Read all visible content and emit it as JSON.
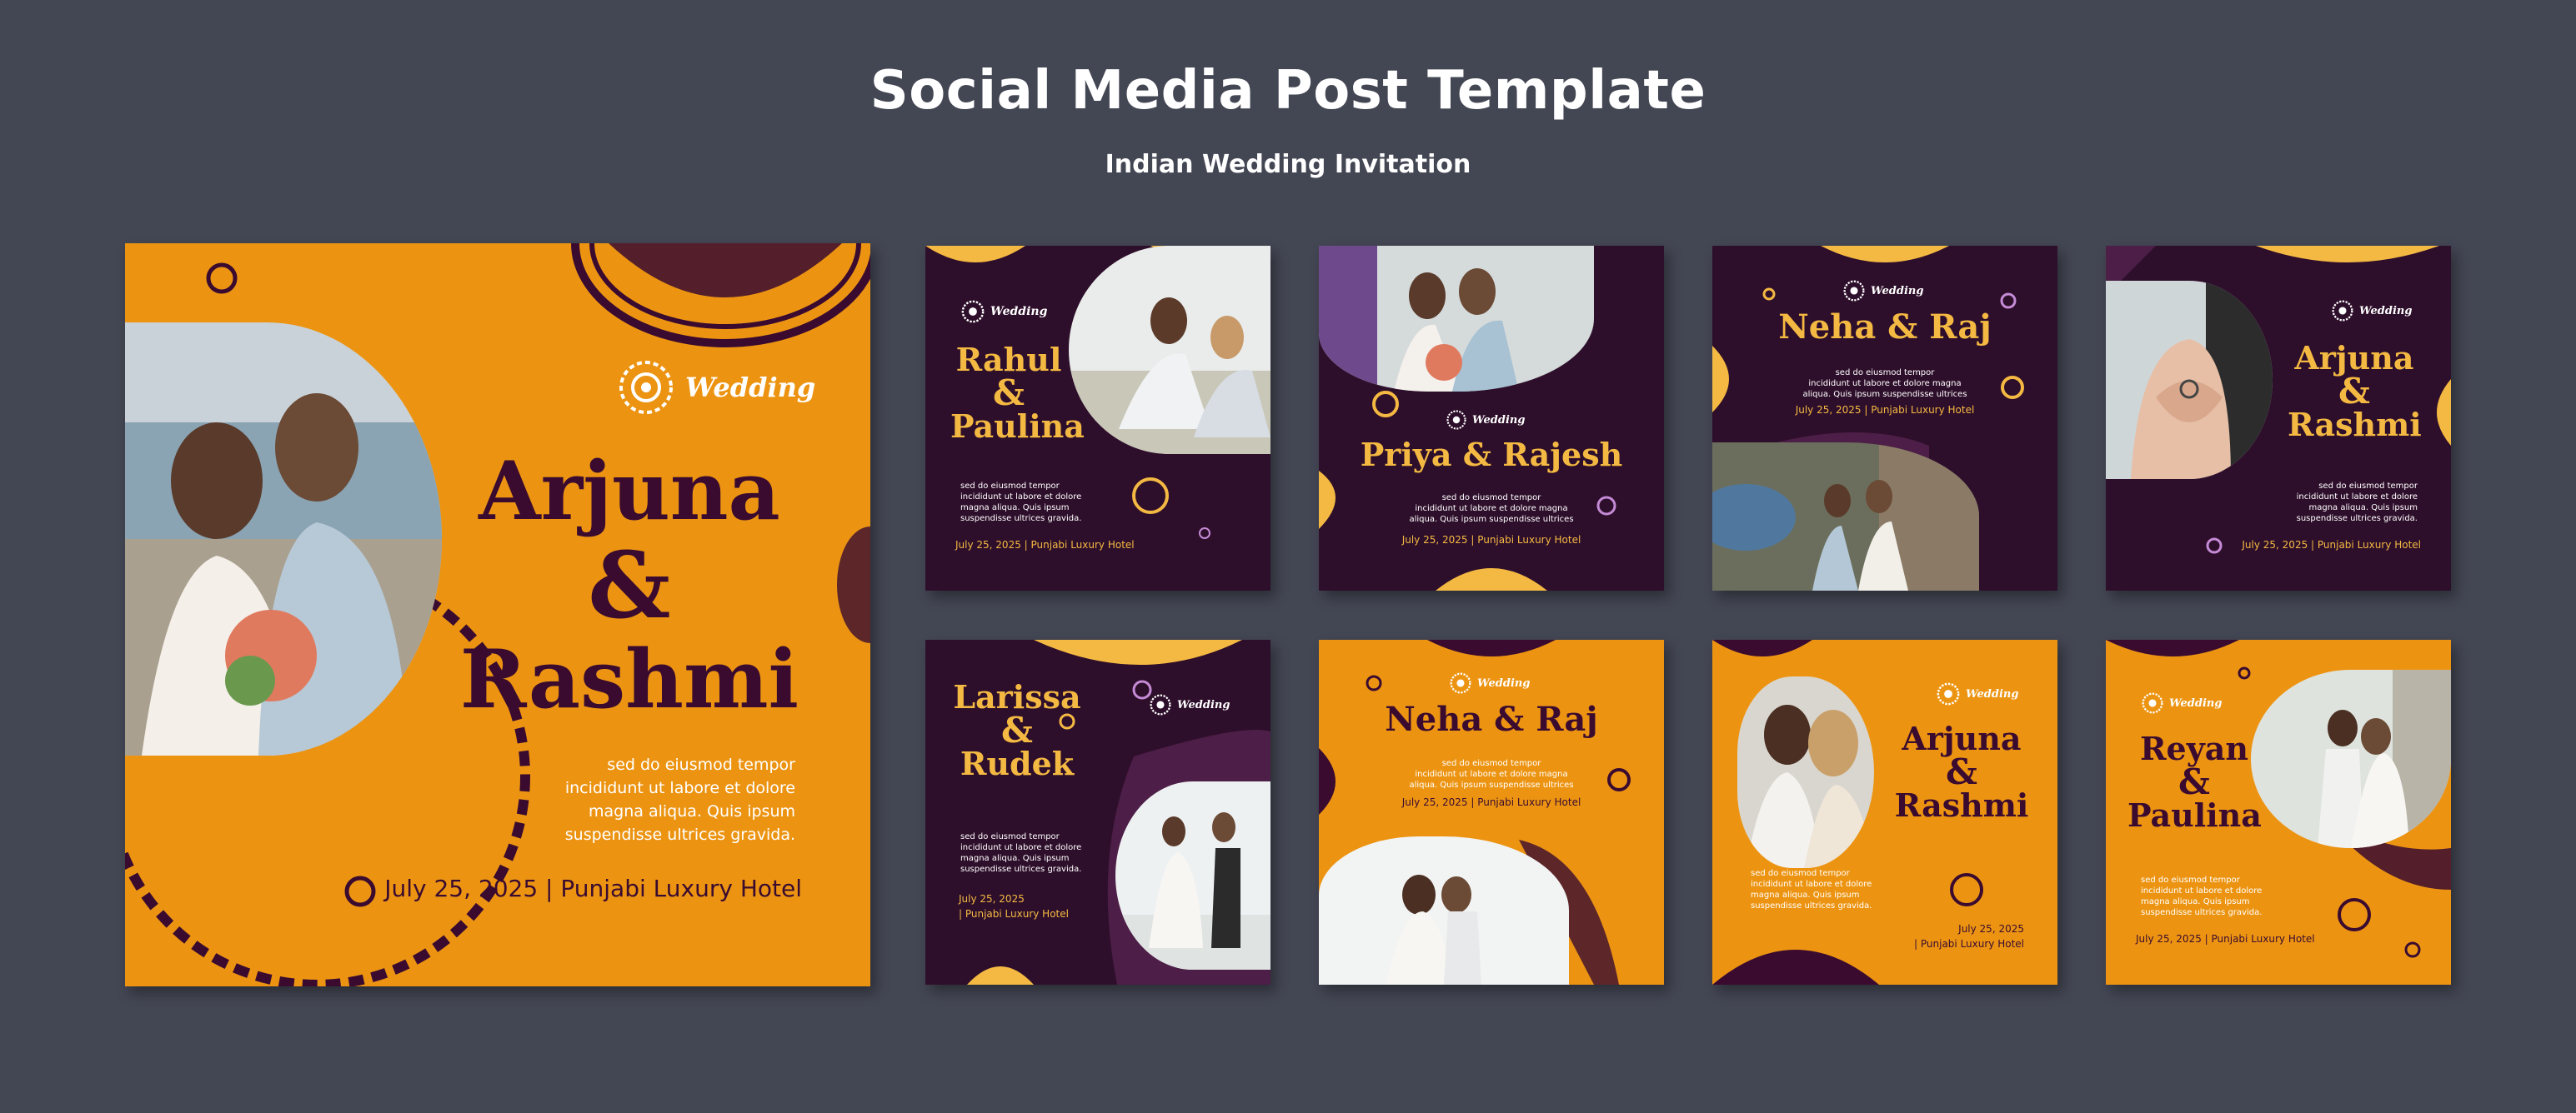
{
  "header": {
    "title": "Social Media Post Template",
    "subtitle": "Indian Wedding Invitation"
  },
  "colors": {
    "background": "#434653",
    "orange": "#ec9412",
    "purple": "#2e0f2b",
    "gold": "#f4b942",
    "dark_text": "#3a0b2f"
  },
  "brand_word": "Wedding",
  "posts": [
    {
      "id": "main",
      "names": [
        "Arjuna",
        "&",
        "Rashmi"
      ],
      "body": [
        "sed do eiusmod tempor",
        "incididunt ut labore et dolore",
        "magna aliqua. Quis ipsum",
        "suspendisse ultrices gravida."
      ],
      "date_line": "July 25, 2025 | Punjabi Luxury Hotel"
    },
    {
      "id": "rahul",
      "names": [
        "Rahul",
        "&",
        "Paulina"
      ],
      "body": [
        "sed do eiusmod tempor",
        "incididunt ut labore et dolore",
        "magna aliqua. Quis ipsum",
        "suspendisse ultrices gravida."
      ],
      "date_line": "July 25, 2025 | Punjabi Luxury Hotel"
    },
    {
      "id": "priya",
      "names": [
        "Priya & Rajesh"
      ],
      "body": [
        "sed do eiusmod tempor",
        "incididunt ut labore et dolore magna",
        "aliqua. Quis ipsum suspendisse ultrices"
      ],
      "date_line": "July 25, 2025 | Punjabi Luxury Hotel"
    },
    {
      "id": "neha-purple",
      "names": [
        "Neha & Raj"
      ],
      "body": [
        "sed do eiusmod tempor",
        "incididunt ut labore et dolore magna",
        "aliqua. Quis ipsum suspendisse ultrices"
      ],
      "date_line": "July 25, 2025 | Punjabi Luxury Hotel"
    },
    {
      "id": "arjuna-purple",
      "names": [
        "Arjuna",
        "&",
        "Rashmi"
      ],
      "body": [
        "sed do eiusmod tempor",
        "incididunt ut labore et dolore",
        "magna aliqua. Quis ipsum",
        "suspendisse ultrices gravida."
      ],
      "date_line": "July 25, 2025 | Punjabi Luxury Hotel"
    },
    {
      "id": "larissa",
      "names": [
        "Larissa",
        "&",
        "Rudek"
      ],
      "body": [
        "sed do eiusmod tempor",
        "incididunt ut labore et dolore",
        "magna aliqua. Quis ipsum",
        "suspendisse ultrices gravida."
      ],
      "date_line": [
        "July 25, 2025",
        "| Punjabi Luxury Hotel"
      ]
    },
    {
      "id": "neha-orange",
      "names": [
        "Neha & Raj"
      ],
      "body": [
        "sed do eiusmod tempor",
        "incididunt ut labore et dolore magna",
        "aliqua. Quis ipsum suspendisse ultrices"
      ],
      "date_line": "July 25, 2025 | Punjabi Luxury Hotel"
    },
    {
      "id": "arjuna-orange",
      "names": [
        "Arjuna",
        "&",
        "Rashmi"
      ],
      "body": [
        "sed do eiusmod tempor",
        "incididunt ut labore et dolore",
        "magna aliqua. Quis ipsum",
        "suspendisse ultrices gravida."
      ],
      "date_line": [
        "July 25, 2025",
        "| Punjabi Luxury Hotel"
      ]
    },
    {
      "id": "reyan",
      "names": [
        "Reyan",
        "&",
        "Paulina"
      ],
      "body": [
        "sed do eiusmod tempor",
        "incididunt ut labore et dolore",
        "magna aliqua. Quis ipsum",
        "suspendisse ultrices gravida."
      ],
      "date_line": "July 25, 2025 | Punjabi Luxury Hotel"
    }
  ]
}
